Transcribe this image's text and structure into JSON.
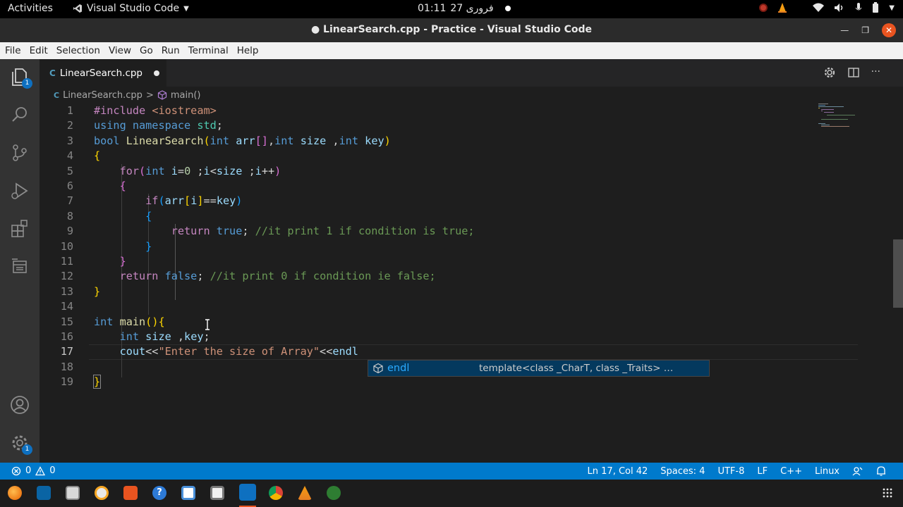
{
  "topbar": {
    "activities": "Activities",
    "app_name": "Visual Studio Code",
    "clock_time": "01:11",
    "clock_date": "27 فروری"
  },
  "window": {
    "title": "● LinearSearch.cpp - Practice - Visual Studio Code"
  },
  "menubar": [
    "File",
    "Edit",
    "Selection",
    "View",
    "Go",
    "Run",
    "Terminal",
    "Help"
  ],
  "activitybar": {
    "explorer_badge": "1",
    "settings_badge": "1"
  },
  "tab": {
    "icon_text": "C",
    "filename": "LinearSearch.cpp"
  },
  "breadcrumb": {
    "file": "LinearSearch.cpp",
    "separator": ">",
    "symbol": "main()"
  },
  "code": {
    "line_numbers": [
      "1",
      "2",
      "3",
      "4",
      "5",
      "6",
      "7",
      "8",
      "9",
      "10",
      "11",
      "12",
      "13",
      "14",
      "15",
      "16",
      "17",
      "18",
      "19"
    ],
    "current_line": 17
  },
  "suggest": {
    "label": "endl",
    "detail": "template<class _CharT, class _Traits> …"
  },
  "statusbar": {
    "errors": "0",
    "warnings": "0",
    "position": "Ln 17, Col 42",
    "spaces": "Spaces: 4",
    "encoding": "UTF-8",
    "eol": "LF",
    "language": "C++",
    "platform": "Linux"
  },
  "colors": {
    "statusbar": "#007acc",
    "activitybar": "#333333",
    "editor_bg": "#1e1e1e",
    "ubuntu_orange": "#e95420"
  },
  "icons": [
    "files-icon",
    "search-icon",
    "source-control-icon",
    "run-debug-icon",
    "extensions-icon",
    "remote-explorer-icon",
    "account-icon",
    "settings-gear-icon"
  ]
}
